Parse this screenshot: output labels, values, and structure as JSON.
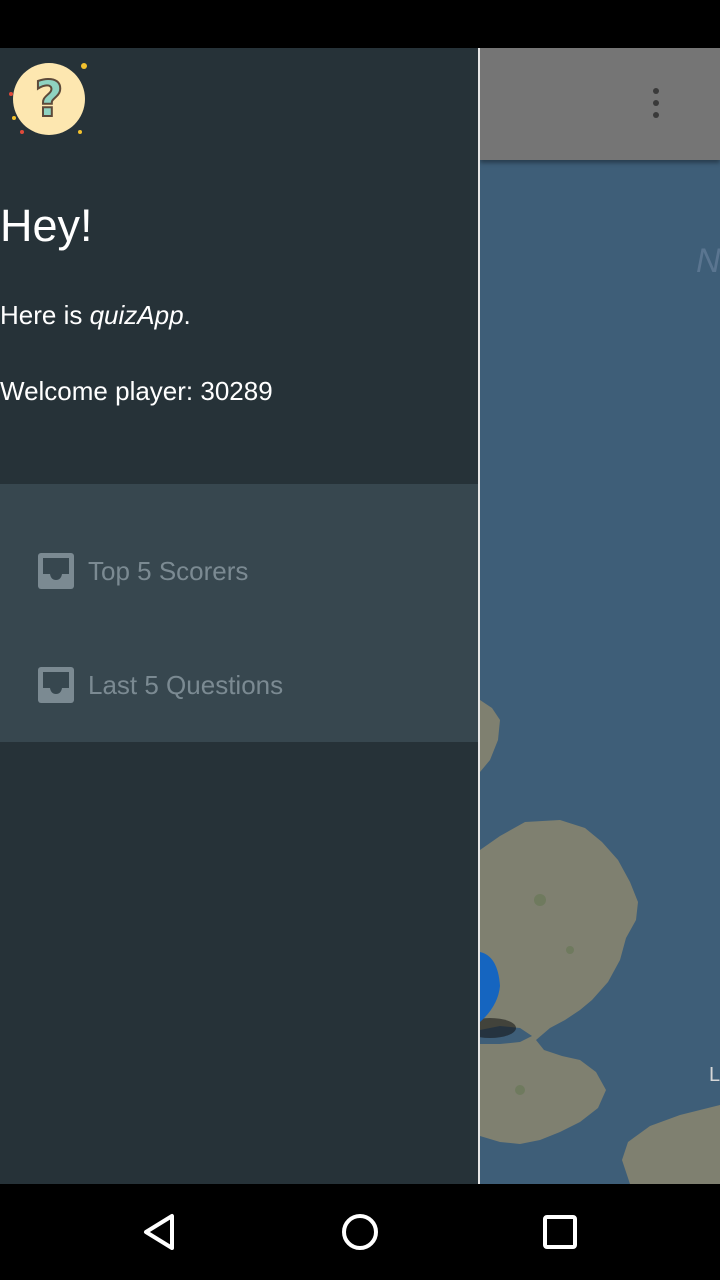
{
  "drawer": {
    "greeting": "Hey!",
    "intro_prefix": "Here is ",
    "app_name": "quizApp",
    "intro_suffix": ".",
    "welcome": "Welcome player: 30289",
    "menu": [
      {
        "label": "Top 5 Scorers",
        "icon": "inbox-icon"
      },
      {
        "label": "Last 5 Questions",
        "icon": "inbox-icon"
      }
    ]
  },
  "app": {
    "toolbar_menu_icon": "more-vert-icon",
    "map_labels": [
      "N",
      "L"
    ]
  },
  "nav_bar": {
    "back_icon": "back-icon",
    "home_icon": "home-icon",
    "recent_icon": "recent-apps-icon"
  },
  "colors": {
    "drawer_bg": "#263238",
    "menu_bg": "#37474f",
    "toolbar": "#757575",
    "sea": "#3e5e78",
    "land": "#7f8070"
  }
}
